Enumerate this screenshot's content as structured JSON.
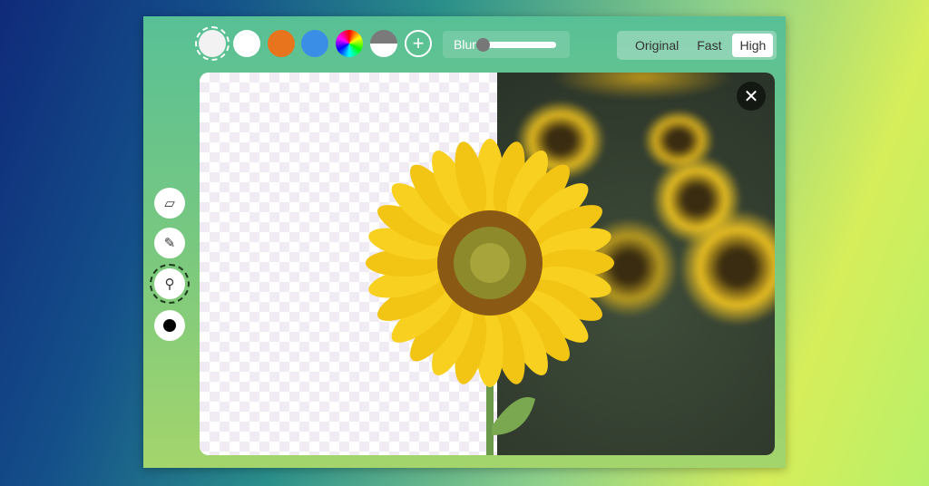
{
  "palette": {
    "swatches": [
      {
        "name": "transparent",
        "color": "#f4f4f4",
        "selected": true
      },
      {
        "name": "white",
        "color": "#ffffff"
      },
      {
        "name": "orange",
        "color": "#e8741e"
      },
      {
        "name": "blue",
        "color": "#3b8ee6"
      },
      {
        "name": "color-wheel",
        "color": "conic"
      },
      {
        "name": "gray-white",
        "color": "#7a7a7a"
      }
    ],
    "add_icon": "plus-icon"
  },
  "blur": {
    "label": "Blur",
    "value": 0
  },
  "quality": {
    "options": [
      "Original",
      "Fast",
      "High"
    ],
    "selected": "High"
  },
  "tools": [
    {
      "icon": "eraser-icon"
    },
    {
      "icon": "pencil-icon"
    },
    {
      "icon": "eyedropper-icon",
      "selected": true
    },
    {
      "icon": "brush-dot-icon"
    }
  ],
  "close_icon": "close-icon"
}
